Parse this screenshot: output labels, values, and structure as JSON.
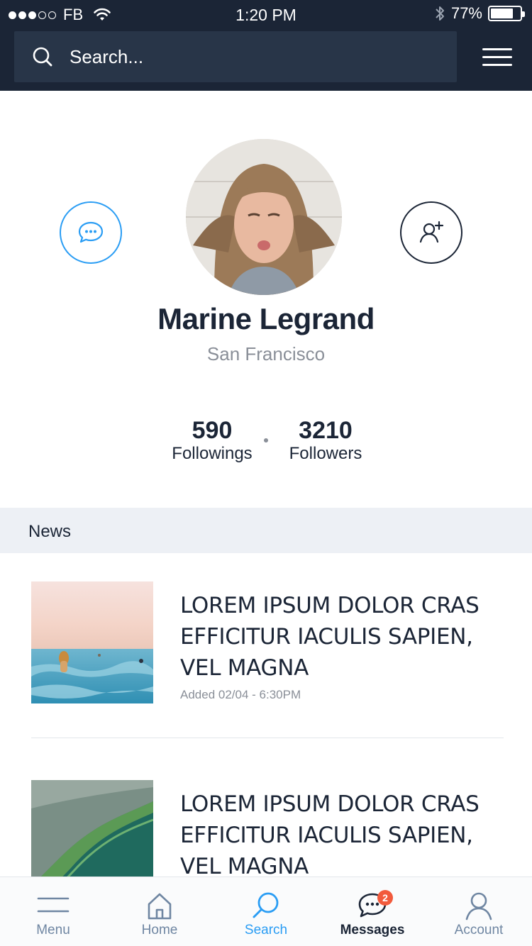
{
  "status_bar": {
    "carrier": "FB",
    "time": "1:20 PM",
    "battery": "77%",
    "battery_level": 0.77,
    "signal_bars_filled": 3,
    "signal_bars_total": 5
  },
  "search": {
    "placeholder": "Search..."
  },
  "profile": {
    "name": "Marine Legrand",
    "location": "San Francisco",
    "followings_count": "590",
    "followings_label": "Followings",
    "followers_count": "3210",
    "followers_label": "Followers"
  },
  "news": {
    "title": "News",
    "items": [
      {
        "headline": "LOREM IPSUM DOLOR CRAS EFFICITUR IACULIS SAPIEN, VEL MAGNA",
        "meta": "Added 02/04 - 6:30PM"
      },
      {
        "headline": "LOREM IPSUM DOLOR CRAS EFFICITUR IACULIS SAPIEN, VEL MAGNA",
        "meta": ""
      }
    ]
  },
  "tabbar": {
    "tabs": [
      {
        "label": "Menu",
        "icon": "menu-icon"
      },
      {
        "label": "Home",
        "icon": "home-icon"
      },
      {
        "label": "Search",
        "icon": "search-icon"
      },
      {
        "label": "Messages",
        "icon": "chat-icon"
      },
      {
        "label": "Account",
        "icon": "user-icon"
      }
    ],
    "active_tab": "Search",
    "messages_badge": "2"
  },
  "colors": {
    "header_bg": "#1b2536",
    "accent": "#2a9df4",
    "badge": "#f25a3c",
    "section_bg": "#edf0f5"
  }
}
